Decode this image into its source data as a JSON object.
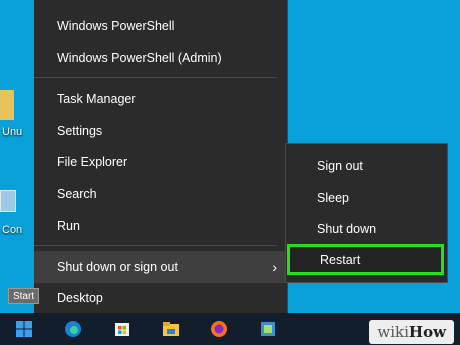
{
  "desktop": {
    "icons": [
      {
        "name": "folder-icon",
        "label": "Unu"
      },
      {
        "name": "computer-icon",
        "label": "Con"
      }
    ]
  },
  "winx_menu": {
    "items": [
      {
        "label": "Windows PowerShell"
      },
      {
        "label": "Windows PowerShell (Admin)"
      },
      {
        "label": "Task Manager"
      },
      {
        "label": "Settings"
      },
      {
        "label": "File Explorer"
      },
      {
        "label": "Search"
      },
      {
        "label": "Run"
      },
      {
        "label": "Shut down or sign out"
      },
      {
        "label": "Desktop"
      }
    ],
    "hovered": "Shut down or sign out"
  },
  "shutdown_submenu": {
    "items": [
      {
        "label": "Sign out"
      },
      {
        "label": "Sleep"
      },
      {
        "label": "Shut down"
      },
      {
        "label": "Restart"
      }
    ],
    "highlighted": "Restart",
    "highlight_color": "#25e11b"
  },
  "tooltip": "Start",
  "taskbar": {
    "icons": [
      "windows-start-icon",
      "edge-icon",
      "store-icon",
      "file-explorer-icon",
      "firefox-icon",
      "app-icon"
    ]
  },
  "watermark": {
    "prefix": "wiki",
    "suffix": "How"
  },
  "colors": {
    "desktop": "#0aa1d8",
    "menu_bg": "#2b2b2b",
    "taskbar": "#121e2b"
  }
}
